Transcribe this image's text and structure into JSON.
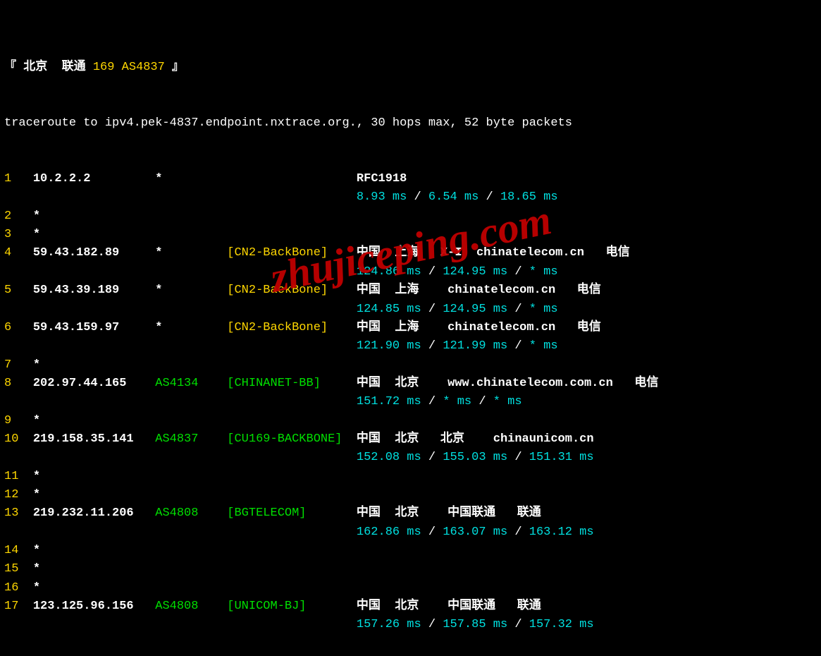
{
  "header": {
    "prefix": "『 北京  联通 ",
    "asn": "169 AS4837",
    "suffix": " 』"
  },
  "cmdline": "traceroute to ipv4.pek-4837.endpoint.nxtrace.org., 30 hops max, 52 byte packets",
  "watermark": "zhujiceping.com",
  "hops": [
    {
      "n": "1",
      "ip": "10.2.2.2",
      "asn": "*",
      "tag": "",
      "loc": "RFC1918",
      "t1": "8.93 ms",
      "t2": "6.54 ms",
      "t3": "18.65 ms"
    },
    {
      "n": "2",
      "ip": "*",
      "asn": "",
      "tag": "",
      "loc": "",
      "t1": "",
      "t2": "",
      "t3": ""
    },
    {
      "n": "3",
      "ip": "*",
      "asn": "",
      "tag": "",
      "loc": "",
      "t1": "",
      "t2": "",
      "t3": ""
    },
    {
      "n": "4",
      "ip": "59.43.182.89",
      "asn": "*",
      "tag": "[CN2-BackBone]",
      "tagcolor": "yellow",
      "loc": "中国  上海   X-I  chinatelecom.cn   电信",
      "t1": "124.86 ms",
      "t2": "124.95 ms",
      "t3": "* ms"
    },
    {
      "n": "5",
      "ip": "59.43.39.189",
      "asn": "*",
      "tag": "[CN2-BackBone]",
      "tagcolor": "yellow",
      "loc": "中国  上海    chinatelecom.cn   电信",
      "t1": "124.85 ms",
      "t2": "124.95 ms",
      "t3": "* ms"
    },
    {
      "n": "6",
      "ip": "59.43.159.97",
      "asn": "*",
      "tag": "[CN2-BackBone]",
      "tagcolor": "yellow",
      "loc": "中国  上海    chinatelecom.cn   电信",
      "t1": "121.90 ms",
      "t2": "121.99 ms",
      "t3": "* ms"
    },
    {
      "n": "7",
      "ip": "*",
      "asn": "",
      "tag": "",
      "loc": "",
      "t1": "",
      "t2": "",
      "t3": ""
    },
    {
      "n": "8",
      "ip": "202.97.44.165",
      "asn": "AS4134",
      "tag": "[CHINANET-BB]",
      "tagcolor": "green",
      "loc": "中国  北京    www.chinatelecom.com.cn   电信",
      "t1": "151.72 ms",
      "t2": "* ms",
      "t3": "* ms"
    },
    {
      "n": "9",
      "ip": "*",
      "asn": "",
      "tag": "",
      "loc": "",
      "t1": "",
      "t2": "",
      "t3": ""
    },
    {
      "n": "10",
      "ip": "219.158.35.141",
      "asn": "AS4837",
      "tag": "[CU169-BACKBONE]",
      "tagcolor": "green",
      "loc": "中国  北京   北京    chinaunicom.cn",
      "t1": "152.08 ms",
      "t2": "155.03 ms",
      "t3": "151.31 ms"
    },
    {
      "n": "11",
      "ip": "*",
      "asn": "",
      "tag": "",
      "loc": "",
      "t1": "",
      "t2": "",
      "t3": ""
    },
    {
      "n": "12",
      "ip": "*",
      "asn": "",
      "tag": "",
      "loc": "",
      "t1": "",
      "t2": "",
      "t3": ""
    },
    {
      "n": "13",
      "ip": "219.232.11.206",
      "asn": "AS4808",
      "tag": "[BGTELECOM]",
      "tagcolor": "green",
      "loc": "中国  北京    中国联通   联通",
      "t1": "162.86 ms",
      "t2": "163.07 ms",
      "t3": "163.12 ms"
    },
    {
      "n": "14",
      "ip": "*",
      "asn": "",
      "tag": "",
      "loc": "",
      "t1": "",
      "t2": "",
      "t3": ""
    },
    {
      "n": "15",
      "ip": "*",
      "asn": "",
      "tag": "",
      "loc": "",
      "t1": "",
      "t2": "",
      "t3": ""
    },
    {
      "n": "16",
      "ip": "*",
      "asn": "",
      "tag": "",
      "loc": "",
      "t1": "",
      "t2": "",
      "t3": ""
    },
    {
      "n": "17",
      "ip": "123.125.96.156",
      "asn": "AS4808",
      "tag": "[UNICOM-BJ]",
      "tagcolor": "green",
      "loc": "中国  北京    中国联通   联通",
      "t1": "157.26 ms",
      "t2": "157.85 ms",
      "t3": "157.32 ms"
    }
  ]
}
